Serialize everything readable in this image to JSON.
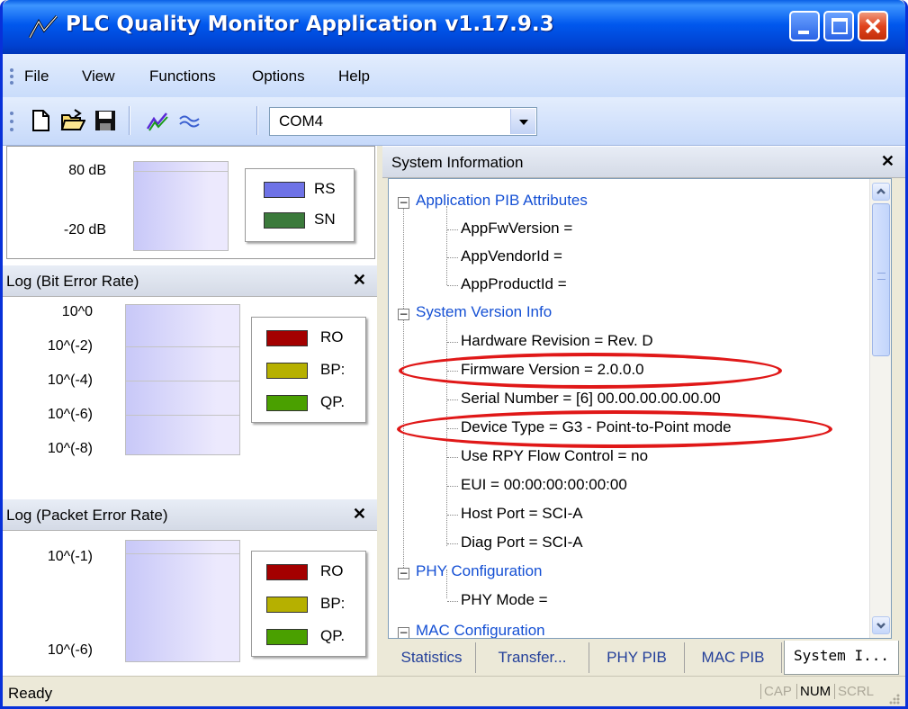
{
  "window": {
    "title": "PLC Quality Monitor Application v1.17.9.3"
  },
  "menu": {
    "file": "File",
    "view": "View",
    "functions": "Functions",
    "options": "Options",
    "help": "Help"
  },
  "toolbar": {
    "port": "COM4",
    "icons": [
      "new-file-icon",
      "open-folder-icon",
      "save-disk-icon",
      "line-chart-icon",
      "wave-icon"
    ]
  },
  "snr_panel": {
    "y_top": "80 dB",
    "y_bottom": "-20 dB",
    "legend": [
      "RS",
      "SN"
    ],
    "colors": [
      "#6e72e6",
      "#3b7a3b"
    ]
  },
  "ber_panel": {
    "title": "Log (Bit Error Rate)",
    "ticks": [
      "10^0",
      "10^(-2)",
      "10^(-4)",
      "10^(-6)",
      "10^(-8)"
    ],
    "legend": [
      "RO",
      "BP:",
      "QP."
    ],
    "colors": [
      "#a40000",
      "#b6b000",
      "#4aa000"
    ]
  },
  "per_panel": {
    "title": "Log (Packet Error Rate)",
    "ticks": [
      "10^(-1)",
      "10^(-6)"
    ],
    "legend": [
      "RO",
      "BP:",
      "QP."
    ]
  },
  "system_info": {
    "title": "System Information",
    "groups": [
      {
        "label": "Application PIB Attributes",
        "items": [
          "AppFwVersion =",
          "AppVendorId =",
          "AppProductId ="
        ]
      },
      {
        "label": "System Version Info",
        "items": [
          "Hardware Revision = Rev. D",
          "Firmware Version = 2.0.0.0",
          "Serial Number = [6] 00.00.00.00.00.00",
          "Device Type = G3 - Point-to-Point mode",
          "Use RPY Flow Control = no",
          "EUI = 00:00:00:00:00:00",
          "Host Port = SCI-A",
          "Diag Port = SCI-A"
        ]
      },
      {
        "label": "PHY Configuration",
        "items": [
          "PHY Mode ="
        ]
      },
      {
        "label": "MAC Configuration"
      }
    ],
    "tabs": [
      "Statistics",
      "Transfer...",
      "PHY PIB",
      "MAC PIB",
      "System I..."
    ]
  },
  "status": {
    "text": "Ready",
    "cap": "CAP",
    "num": "NUM",
    "scrl": "SCRL"
  },
  "colors": {
    "group_link": "#1550d4",
    "highlight_ellipse": "#e01818",
    "title_bar": "#0058ee"
  }
}
